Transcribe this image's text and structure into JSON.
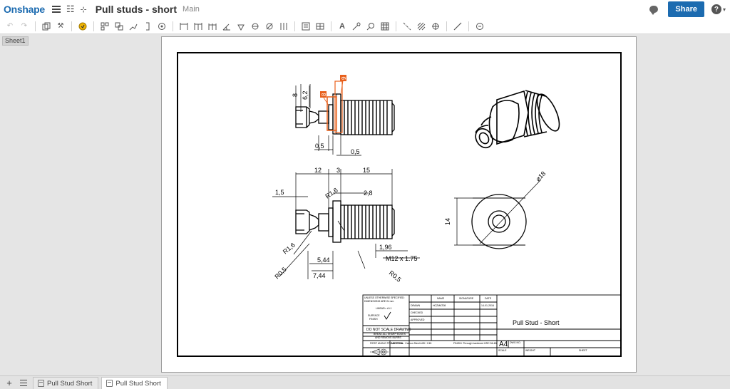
{
  "header": {
    "brand": "Onshape",
    "document_title": "Pull studs - short",
    "branch": "Main",
    "share_label": "Share",
    "help_label": "?"
  },
  "sheet": {
    "tab_label": "Sheet1"
  },
  "drawing": {
    "dims": {
      "d8": "8",
      "d62": "6,2",
      "d05a": "0,5",
      "d05b": "0,5",
      "d12": "12",
      "d3": "3",
      "d15": "15",
      "d15b": "1,5",
      "r16top": "R1,6",
      "d28": "2,8",
      "r16": "R1,6",
      "d196": "1,96",
      "m12": "M12 x 1.75",
      "d544": "5,44",
      "d744": "7,44",
      "r05a": "R0,5",
      "r05b": "R0,5",
      "d14": "14",
      "dia18": "⌀18"
    },
    "balloons": {
      "b8": "8",
      "b9": "9"
    },
    "title_block": {
      "unless": "UNLESS OTHERWISE SPECIFIED:",
      "dims_in": "DIMENSIONS ARE IN mm",
      "linear": "LINEAR= ±0.1",
      "surface": "SURFACE",
      "finish": "FINISH",
      "noscale": "DO NOT SCALE DRAWING",
      "break": "BREAK ALL SHARP EDGES",
      "burrs": "AND REMOVE BURRS",
      "projection": "FIRST ANGLE PROJECTION",
      "col_name": "NAME",
      "col_sig": "SIGNATURE",
      "col_date": "DATE",
      "row_drawn": "DRAWN",
      "row_checked": "CHECKED",
      "row_approved": "APPROVED",
      "drawn_name": "HCZMAT08",
      "drawn_date": "14-01-2016",
      "material": "MATERIAL: Carbon Steel AISI / C45",
      "finish_note": "FINISH: Through hardened HRC 56-60",
      "title": "Pull Stud - Short",
      "size": "A4",
      "dwg_no": "DWG NO.",
      "scale": "SCALE",
      "weight": "WEIGHT",
      "sheet": "SHEET"
    }
  },
  "bottom": {
    "tabs": [
      {
        "label": "Pull Stud Short"
      },
      {
        "label": "Pull Stud Short"
      }
    ]
  }
}
